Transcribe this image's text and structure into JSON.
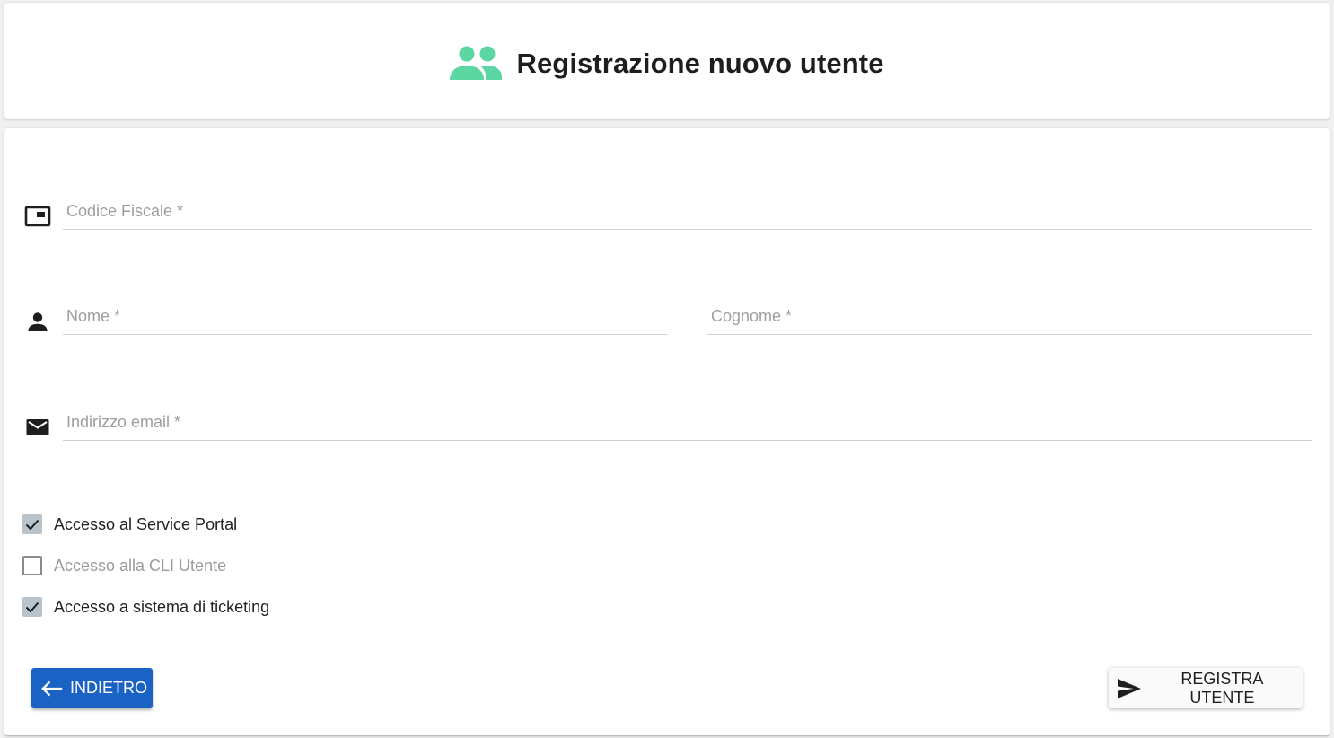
{
  "header": {
    "icon": "group-icon",
    "title": "Registrazione nuovo utente",
    "icon_color": "#5cd6a3"
  },
  "form": {
    "codice_fiscale": {
      "icon": "badge-icon",
      "placeholder": "Codice Fiscale *",
      "value": ""
    },
    "nome": {
      "icon": "person-icon",
      "placeholder": "Nome *",
      "value": ""
    },
    "cognome": {
      "placeholder": "Cognome *",
      "value": ""
    },
    "email": {
      "icon": "mail-icon",
      "placeholder": "Indirizzo email *",
      "value": ""
    }
  },
  "permissions": [
    {
      "label": "Accesso al Service Portal",
      "checked": true
    },
    {
      "label": "Accesso alla CLI Utente",
      "checked": false
    },
    {
      "label": "Accesso a sistema di ticketing",
      "checked": true
    }
  ],
  "actions": {
    "back_label": "INDIETRO",
    "back_icon": "arrow-left-icon",
    "register_label": "REGISTRA UTENTE",
    "register_icon": "send-icon"
  },
  "colors": {
    "primary": "#1a63c4",
    "accent": "#5cd6a3",
    "checkbox_checked": "#b8c3cc"
  }
}
